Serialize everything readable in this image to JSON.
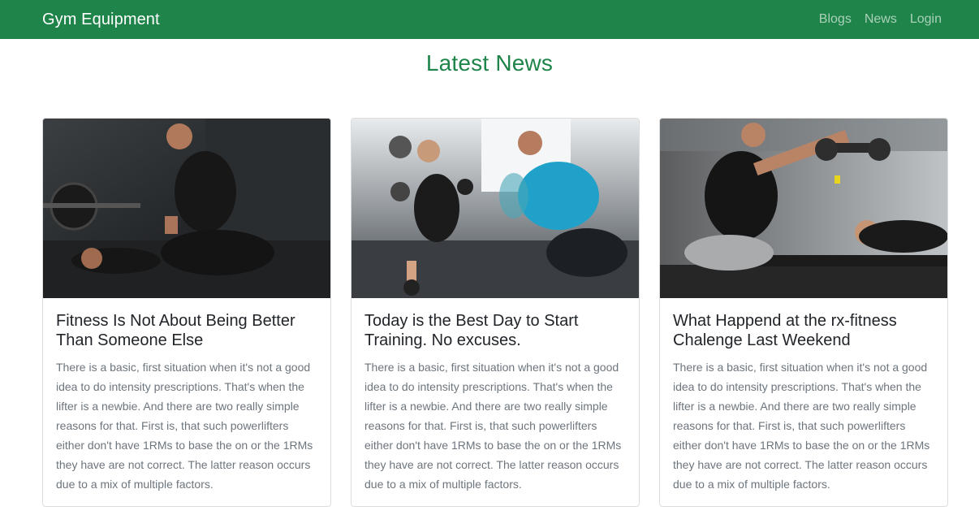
{
  "nav": {
    "brand": "Gym Equipment",
    "links": [
      "Blogs",
      "News",
      "Login"
    ]
  },
  "section": {
    "title": "Latest News"
  },
  "cards": [
    {
      "title": "Fitness Is Not About Being Better Than Someone Else",
      "text": "There is a basic, first situation when it's not a good idea to do intensity prescriptions. That's when the lifter is a newbie. And there are two really simple reasons for that. First is, that such powerlifters either don't have 1RMs to base the on or the 1RMs they have are not correct. The latter reason occurs due to a mix of multiple factors."
    },
    {
      "title": "Today is the Best Day to Start Training. No excuses.",
      "text": "There is a basic, first situation when it's not a good idea to do intensity prescriptions. That's when the lifter is a newbie. And there are two really simple reasons for that. First is, that such powerlifters either don't have 1RMs to base the on or the 1RMs they have are not correct. The latter reason occurs due to a mix of multiple factors."
    },
    {
      "title": "What Happend at the rx-fitness Chalenge Last Weekend",
      "text": "There is a basic, first situation when it's not a good idea to do intensity prescriptions. That's when the lifter is a newbie. And there are two really simple reasons for that. First is, that such powerlifters either don't have 1RMs to base the on or the 1RMs they have are not correct. The latter reason occurs due to a mix of multiple factors."
    }
  ],
  "colors": {
    "brand_green": "#1e8449",
    "muted_text": "#6c757d"
  }
}
